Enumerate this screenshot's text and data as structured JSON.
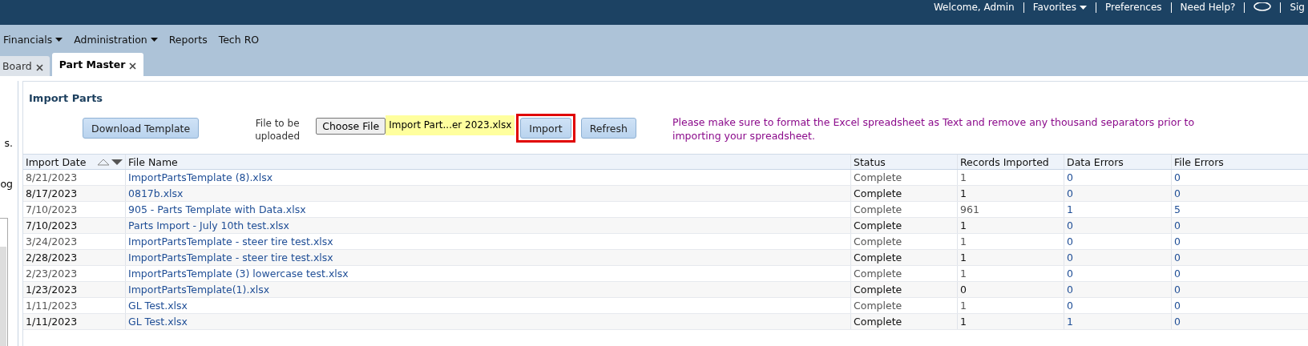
{
  "header": {
    "links": [
      {
        "kind": "text",
        "label": "Welcome, Admin"
      },
      {
        "kind": "menu",
        "label": "Favorites"
      },
      {
        "kind": "link",
        "label": "Preferences"
      },
      {
        "kind": "link",
        "label": "Need Help?"
      },
      {
        "kind": "icon"
      },
      {
        "kind": "link",
        "label": "Sig"
      }
    ]
  },
  "menu": [
    {
      "label": "Financials",
      "dropdown": true
    },
    {
      "label": "Administration",
      "dropdown": true
    },
    {
      "label": "Reports",
      "dropdown": false
    },
    {
      "label": "Tech RO",
      "dropdown": false
    }
  ],
  "tabs": [
    {
      "label": "Board",
      "selected": false
    },
    {
      "label": "Part Master",
      "selected": true
    }
  ],
  "sidebar": {
    "fragments": [
      "s.",
      "og"
    ]
  },
  "panel": {
    "title": "Import Parts",
    "download_button": "Download Template",
    "file_label": "File to be uploaded",
    "choose_button": "Choose File",
    "file_name": "Import Part...er 2023.xlsx",
    "buttons": [
      {
        "label": "Import",
        "highlighted": true
      },
      {
        "label": "Refresh",
        "highlighted": false
      }
    ],
    "notice": "Please make sure to format the Excel spreadsheet as Text and remove any thousand separators prior to importing your spreadsheet."
  },
  "table": {
    "columns": [
      {
        "label": "Import Date",
        "sort_descending": true
      },
      {
        "label": "File Name"
      },
      {
        "label": "Status"
      },
      {
        "label": "Records Imported"
      },
      {
        "label": "Data Errors"
      },
      {
        "label": "File Errors"
      }
    ],
    "rows": [
      [
        "8/21/2023",
        "ImportPartsTemplate (8).xlsx",
        "Complete",
        "1",
        "0",
        "0"
      ],
      [
        "8/17/2023",
        "0817b.xlsx",
        "Complete",
        "1",
        "0",
        "0"
      ],
      [
        "7/10/2023",
        "905 - Parts Template with Data.xlsx",
        "Complete",
        "961",
        "1",
        "5"
      ],
      [
        "7/10/2023",
        "Parts Import - July 10th test.xlsx",
        "Complete",
        "1",
        "0",
        "0"
      ],
      [
        "3/24/2023",
        "ImportPartsTemplate - steer tire test.xlsx",
        "Complete",
        "1",
        "0",
        "0"
      ],
      [
        "2/28/2023",
        "ImportPartsTemplate - steer tire test.xlsx",
        "Complete",
        "1",
        "0",
        "0"
      ],
      [
        "2/23/2023",
        "ImportPartsTemplate (3) lowercase test.xlsx",
        "Complete",
        "1",
        "0",
        "0"
      ],
      [
        "1/23/2023",
        "ImportPartsTemplate(1).xlsx",
        "Complete",
        "0",
        "0",
        "0"
      ],
      [
        "1/11/2023",
        "GL Test.xlsx",
        "Complete",
        "1",
        "0",
        "0"
      ],
      [
        "1/11/2023",
        "GL Test.xlsx",
        "Complete",
        "1",
        "1",
        "0"
      ]
    ]
  }
}
